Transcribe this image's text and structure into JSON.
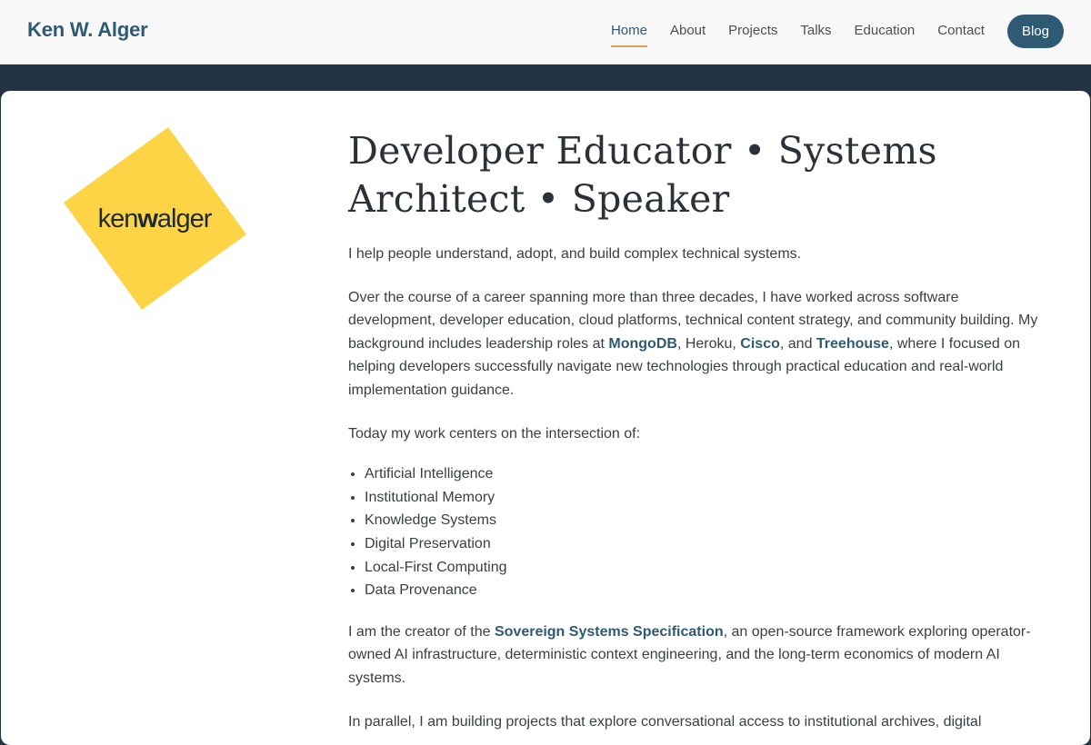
{
  "brand": "Ken W. Alger",
  "nav": {
    "home": "Home",
    "about": "About",
    "projects": "Projects",
    "talks": "Talks",
    "education": "Education",
    "contact": "Contact",
    "blog": "Blog"
  },
  "logo": {
    "text_first": "ken",
    "text_second": "w",
    "text_third": "alger",
    "color": "#fdd446"
  },
  "headline": "Developer Educator • Systems Architect • Speaker",
  "intro": "I help people understand, adopt, and build complex technical systems.",
  "career": {
    "part1": "Over the course of a career spanning more than three decades, I have worked across software development, developer education, cloud platforms, technical content strategy, and community building. My background includes leadership roles at ",
    "link1": "MongoDB",
    "part2": ", Heroku, ",
    "link2": "Cisco",
    "part3": ", and ",
    "link3": "Treehouse",
    "part4": ", where I focused on helping developers successfully navigate new technologies through practical education and real-world implementation guidance."
  },
  "focus_intro": "Today my work centers on the intersection of:",
  "focus_items": [
    "Artificial Intelligence",
    "Institutional Memory",
    "Knowledge Systems",
    "Digital Preservation",
    "Local-First Computing",
    "Data Provenance"
  ],
  "creator": {
    "part1": "I am the creator of the ",
    "link": "Sovereign Systems Specification",
    "part2": ", an open-source framework exploring operator-owned AI infrastructure, deterministic context engineering, and the long-term economics of modern AI systems."
  },
  "parallel": "In parallel, I am building projects that explore conversational access to institutional archives, digital"
}
